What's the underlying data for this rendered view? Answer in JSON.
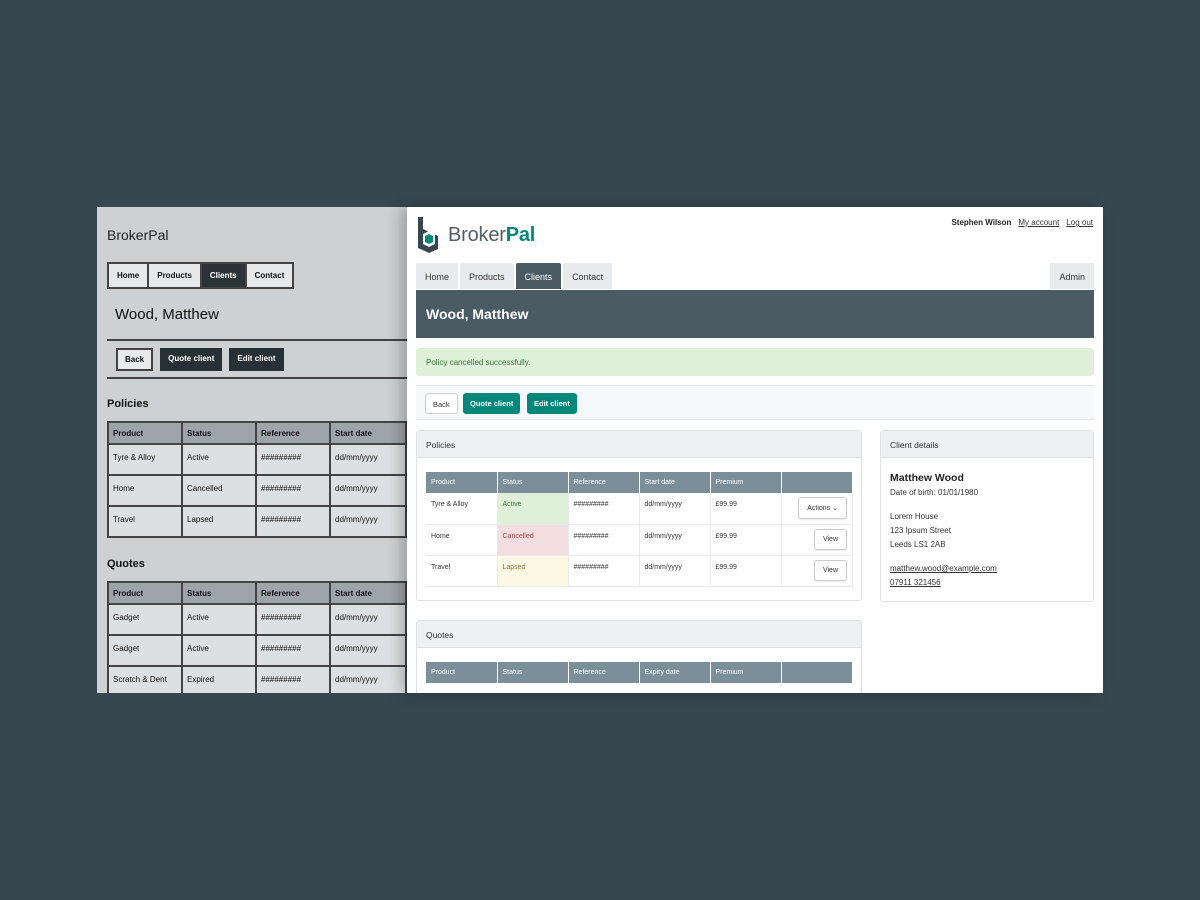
{
  "wireframe": {
    "logo": "BrokerPal",
    "nav": [
      "Home",
      "Products",
      "Clients",
      "Contact"
    ],
    "title": "Wood, Matthew",
    "buttons": [
      "Back",
      "Quote client",
      "Edit client"
    ],
    "policies_heading": "Policies",
    "quotes_heading": "Quotes",
    "columns": [
      "Product",
      "Status",
      "Reference",
      "Start date",
      ""
    ],
    "policies": [
      [
        "Tyre & Alloy",
        "Active",
        "#########",
        "dd/mm/yyyy"
      ],
      [
        "Home",
        "Cancelled",
        "#########",
        "dd/mm/yyyy"
      ],
      [
        "Travel",
        "Lapsed",
        "#########",
        "dd/mm/yyyy"
      ]
    ],
    "quotes": [
      [
        "Gadget",
        "Active",
        "#########",
        "dd/mm/yyyy"
      ],
      [
        "Gadget",
        "Active",
        "#########",
        "dd/mm/yyyy"
      ],
      [
        "Scratch & Dent",
        "Expired",
        "#########",
        "dd/mm/yyyy"
      ]
    ]
  },
  "header": {
    "logo_part1": "Broker",
    "logo_part2": "Pal",
    "user": "Stephen Wilson",
    "my_account": "My account",
    "logout": "Log out"
  },
  "nav": {
    "tabs": [
      {
        "label": "Home"
      },
      {
        "label": "Products"
      },
      {
        "label": "Clients"
      },
      {
        "label": "Contact"
      }
    ],
    "admin": "Admin"
  },
  "page": {
    "title": "Wood, Matthew",
    "alert": "Policy cancelled successfully."
  },
  "toolbar": {
    "back": "Back",
    "quote": "Quote client",
    "edit": "Edit client"
  },
  "policies": {
    "heading": "Policies",
    "columns": [
      "Product",
      "Status",
      "Reference",
      "Start date",
      "Premium",
      ""
    ],
    "rows": [
      {
        "product": "Tyre & Alloy",
        "status": "Active",
        "reference": "#########",
        "date": "dd/mm/yyyy",
        "premium": "£99.99",
        "action": "Actions"
      },
      {
        "product": "Home",
        "status": "Cancelled",
        "reference": "#########",
        "date": "dd/mm/yyyy",
        "premium": "£99.99",
        "action": "View"
      },
      {
        "product": "Travel",
        "status": "Lapsed",
        "reference": "#########",
        "date": "dd/mm/yyyy",
        "premium": "£99.99",
        "action": "View"
      }
    ]
  },
  "quotes": {
    "heading": "Quotes",
    "columns": [
      "Product",
      "Status",
      "Reference",
      "Expiry date",
      "Premium",
      ""
    ]
  },
  "client": {
    "heading": "Client details",
    "name": "Matthew Wood",
    "dob": "Date of birth: 01/01/1980",
    "address1": "Lorem House",
    "address2": "123 Ipsum Street",
    "address3": "Leeds LS1 2AB",
    "email": "matthew.wood@example.com",
    "phone": "07911 321456"
  },
  "colors": {
    "accent": "#00897b",
    "banner": "#4a5b63",
    "table_header": "#7a8f9a"
  }
}
